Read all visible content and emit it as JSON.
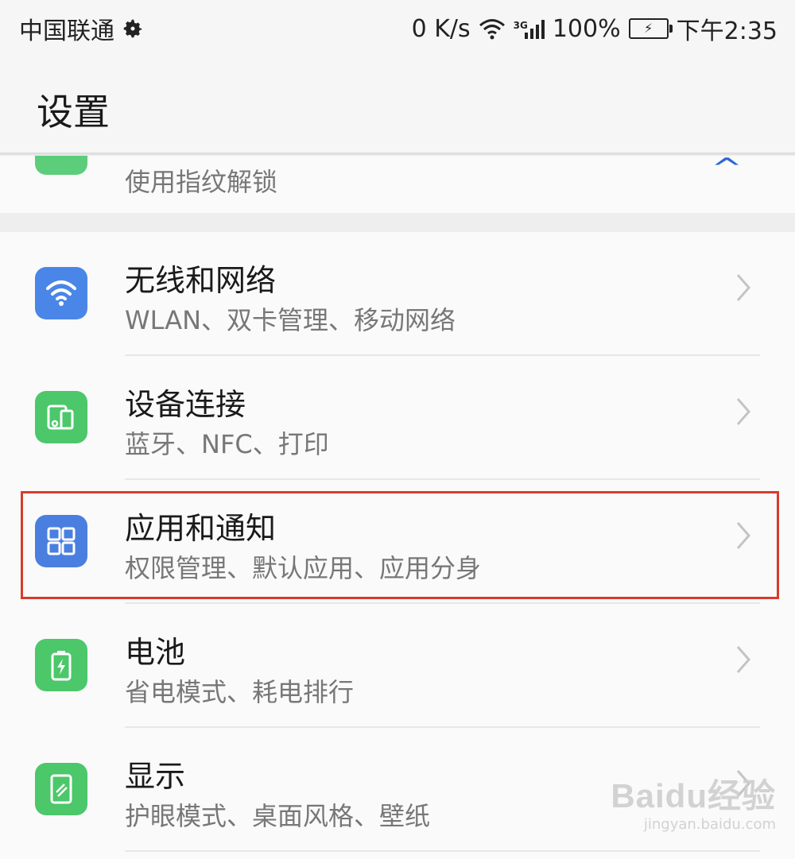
{
  "status_bar": {
    "carrier": "中国联通",
    "speed": "0 K/s",
    "network_type": "3G",
    "battery": "100%",
    "time": "下午2:35"
  },
  "header": {
    "title": "设置"
  },
  "partial_item": {
    "subtitle": "使用指纹解锁"
  },
  "items": [
    {
      "title": "无线和网络",
      "subtitle": "WLAN、双卡管理、移动网络",
      "icon": "wifi-icon",
      "icon_color": "#4a86e8"
    },
    {
      "title": "设备连接",
      "subtitle": "蓝牙、NFC、打印",
      "icon": "device-connection-icon",
      "icon_color": "#4cc76a"
    },
    {
      "title": "应用和通知",
      "subtitle": "权限管理、默认应用、应用分身",
      "icon": "apps-grid-icon",
      "icon_color": "#4a7fe0",
      "highlighted": true
    },
    {
      "title": "电池",
      "subtitle": "省电模式、耗电排行",
      "icon": "battery-icon",
      "icon_color": "#4cc76a"
    },
    {
      "title": "显示",
      "subtitle": "护眼模式、桌面风格、壁纸",
      "icon": "display-icon",
      "icon_color": "#4cc76a"
    }
  ],
  "colors": {
    "highlight_border": "#d93a2b",
    "accent_blue": "#2d67d6"
  },
  "watermark": {
    "brand": "Baidu经验",
    "url": "jingyan.baidu.com"
  }
}
